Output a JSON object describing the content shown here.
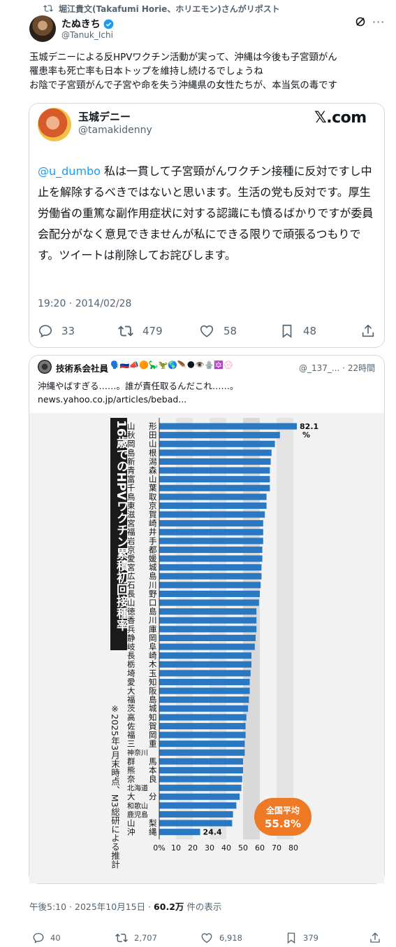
{
  "repost": {
    "text": "堀江貴文(Takafumi Horie、ホリエモン)さんがリポスト",
    "icon": "repost-icon"
  },
  "author": {
    "name": "たぬきち",
    "handle": "@Tanuk_Ichi",
    "verified": true
  },
  "post": {
    "text": "玉城デニーによる反HPVワクチン活動が実って、沖縄は今後も子宮頸がん\n罹患率も死亡率も日本トップを維持し続けるでしょうね\nお陰で子宮頸がんで子宮や命を失う沖縄県の女性たちが、本当気の毒です",
    "time": "午後5:10 · 2025年10月15日 · ",
    "views": "60.2万",
    "views_suffix": " 件の表示"
  },
  "quote": {
    "name": "玉城デニー",
    "handle": "@tamakidenny",
    "brand": "𝕏.com",
    "mention": "@u_dumbo",
    "text": " 私は一貫して子宮頸がんワクチン接種に反対ですし中止を解除するべきではないと思います。生活の党も反対です。厚生労働省の重篤な副作用症状に対する認識にも憤るばかりですが委員会配分がなく意見できませんが私にできる限りで頑張るつもりです。ツイートは削除してお詫びします。",
    "time": "19:20 · 2014/02/28",
    "replies": "33",
    "reposts": "479",
    "likes": "58",
    "bookmarks": "48"
  },
  "quote2": {
    "name": "技術系会社員",
    "emoji": "🗣️🇷🇺📣🟠🦕🦖🌎🪶🌑👁️🪬🔯💮",
    "handle": "@_137_...",
    "age": "· 22時間",
    "text": "沖縄やばすぎる……。誰が責任取るんだこれ……。\nnews.yahoo.co.jp/articles/bebad..."
  },
  "chart_data": {
    "type": "bar",
    "orientation": "horizontal",
    "title": "16歳でのHPVワクチン累積初回接種率",
    "note": "※2025年3月末時点、M3総研による推計",
    "categories": [
      "山形",
      "秋田",
      "岡山",
      "島根",
      "新潟",
      "青森",
      "富山",
      "千葉",
      "鳥取",
      "東京",
      "滋賀",
      "宮崎",
      "福井",
      "岩手",
      "京都",
      "愛媛",
      "宮城",
      "広島",
      "石川",
      "長野",
      "山口",
      "徳島",
      "香川",
      "兵庫",
      "静岡",
      "岐阜",
      "長崎",
      "栃木",
      "埼玉",
      "愛知",
      "大阪",
      "福島",
      "茨城",
      "高知",
      "佐賀",
      "福岡",
      "三重",
      "神奈川",
      "群馬",
      "熊本",
      "奈良",
      "北海道",
      "大分",
      "和歌山",
      "鹿児島",
      "山梨",
      "沖縄"
    ],
    "values": [
      82.1,
      72,
      69,
      67,
      66.5,
      66,
      66,
      66,
      64,
      64,
      63,
      62,
      62,
      62,
      61.5,
      61.5,
      61,
      61,
      60.5,
      60,
      59.5,
      58,
      58,
      58,
      57.5,
      57,
      55,
      55,
      54.5,
      54,
      54,
      53.5,
      53,
      52,
      51.5,
      51.5,
      51,
      51,
      50,
      50,
      49.5,
      49,
      48,
      46,
      44,
      43.5,
      24.4
    ],
    "labeled_values": {
      "山形": "82.1",
      "沖縄": "24.4"
    },
    "value_unit": "%",
    "xlim": [
      0,
      80
    ],
    "xticks": [
      "0%",
      "10",
      "20",
      "30",
      "40",
      "50",
      "60",
      "70",
      "80"
    ],
    "average_label": "全国平均",
    "average_value": "55.8%",
    "bar_color": "#2b78c2"
  },
  "footer": {
    "replies": "40",
    "reposts": "2,707",
    "likes": "6,918",
    "bookmarks": "379"
  }
}
